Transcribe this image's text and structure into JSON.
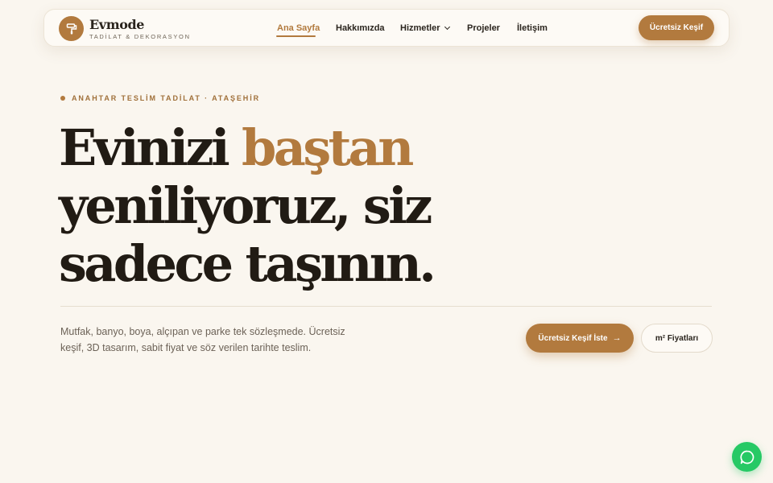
{
  "brand": {
    "name": "Evmode",
    "tagline": "TADİLAT & DEKORASYON",
    "logo_icon": "paint-roller-icon"
  },
  "nav": {
    "items": [
      {
        "label": "Ana Sayfa",
        "active": true
      },
      {
        "label": "Hakkımızda",
        "active": false
      },
      {
        "label": "Hizmetler",
        "active": false,
        "has_dropdown": true
      },
      {
        "label": "Projeler",
        "active": false
      },
      {
        "label": "İletişim",
        "active": false
      }
    ],
    "cta_label": "Ücretsiz Keşif"
  },
  "hero": {
    "eyebrow": "ANAHTAR TESLİM TADİLAT · ATAŞEHİR",
    "headline": {
      "part1": "Evinizi ",
      "accent": "baştan",
      "line2": "yeniliyoruz, siz",
      "line3": "sadece taşının."
    },
    "lede": "Mutfak, banyo, boya, alçıpan ve parke tek sözleşmede. Ücretsiz keşif, 3D tasarım, sabit fiyat ve söz verilen tarihte teslim.",
    "primary_button": "Ücretsiz Keşif İste",
    "secondary_button": "m² Fiyatları"
  },
  "floating": {
    "whatsapp_icon": "whatsapp-chat-icon"
  },
  "colors": {
    "accent": "#b27a3e",
    "background": "#faf6ef",
    "text": "#211b14",
    "whatsapp": "#26c965"
  }
}
